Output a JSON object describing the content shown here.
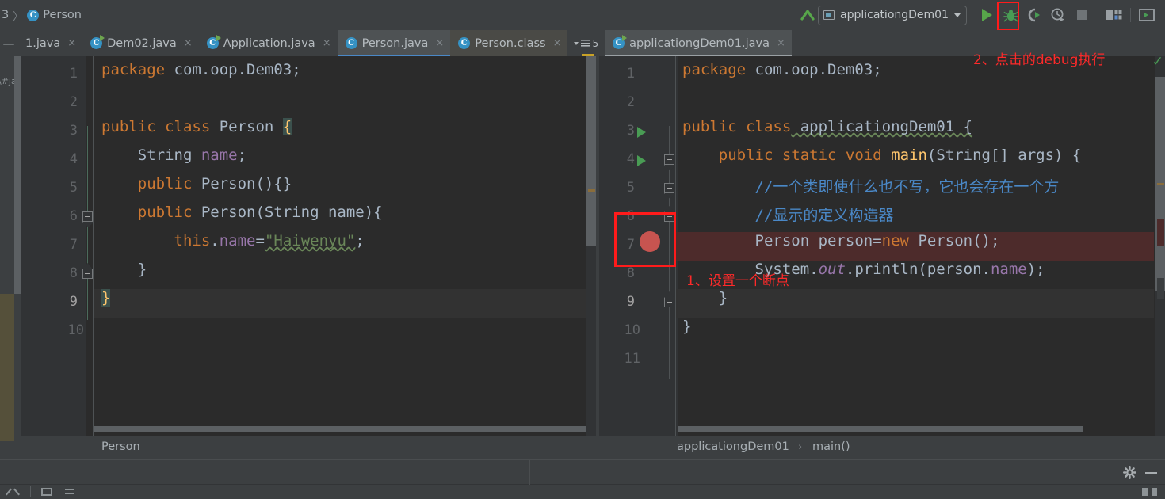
{
  "breadcrumb_top": {
    "prefix": "3",
    "separator": "〉",
    "class_icon": "C",
    "text": "Person"
  },
  "toolbar": {
    "back_arrow_icon": "arrow-up-left-icon",
    "run_config_name": "applicationgDem01",
    "run_config_caret": "▾",
    "buttons": [
      {
        "name": "run-button",
        "icon": "play-icon",
        "label": "Run"
      },
      {
        "name": "debug-button",
        "icon": "bug-icon",
        "label": "Debug"
      },
      {
        "name": "run-with-coverage-button",
        "icon": "coverage-icon",
        "label": "Run with Coverage"
      },
      {
        "name": "profiler-button",
        "icon": "clock-run-icon",
        "label": "Profiler"
      },
      {
        "name": "stop-button",
        "icon": "stop-square-icon",
        "label": "Stop"
      },
      {
        "name": "project-structure-button",
        "icon": "folder-structure-icon",
        "label": "Project Structure"
      },
      {
        "name": "terminal-button",
        "icon": "terminal-icon",
        "label": "Terminal"
      }
    ],
    "highlight_color": "#ff1b1b"
  },
  "tabs": {
    "collapse_label": "—",
    "items": [
      {
        "label": "1.java",
        "icon": "none",
        "state": "inactive",
        "close": "×"
      },
      {
        "label": "Dem02.java",
        "icon": "java-run-class-icon",
        "state": "inactive",
        "close": "×"
      },
      {
        "label": "Application.java",
        "icon": "java-run-class-icon",
        "state": "inactive",
        "close": "×"
      },
      {
        "label": "Person.java",
        "icon": "java-class-icon",
        "state": "active-left",
        "close": "×"
      },
      {
        "label": "Person.class",
        "icon": "java-class-icon",
        "state": "passive-selected",
        "close": "×"
      }
    ],
    "more_count": "5",
    "right_tab": {
      "label": "applicationgDem01.java",
      "icon": "java-run-class-icon",
      "state": "active-right",
      "close": "×"
    }
  },
  "left_editor": {
    "vertical_label": "\\#ja",
    "file": "Person.java",
    "current_line": 9,
    "line_numbers": [
      "1",
      "2",
      "3",
      "4",
      "5",
      "6",
      "7",
      "8",
      "9",
      "10"
    ],
    "lines": [
      {
        "n": 1,
        "segments": [
          {
            "t": "package",
            "c": "k"
          },
          {
            "t": " com.oop.Dem03;",
            "c": "ty"
          }
        ]
      },
      {
        "n": 2,
        "segments": []
      },
      {
        "n": 3,
        "segments": [
          {
            "t": "public class",
            "c": "k"
          },
          {
            "t": " Person ",
            "c": "ty"
          },
          {
            "t": "{",
            "c": "yb"
          }
        ]
      },
      {
        "n": 4,
        "segments": [
          {
            "t": "    String ",
            "c": "ty"
          },
          {
            "t": "name",
            "c": "fld"
          },
          {
            "t": ";",
            "c": "ty"
          }
        ]
      },
      {
        "n": 5,
        "segments": [
          {
            "t": "    ",
            "c": "ty"
          },
          {
            "t": "public",
            "c": "k"
          },
          {
            "t": " Person(){}",
            "c": "ty"
          }
        ]
      },
      {
        "n": 6,
        "segments": [
          {
            "t": "    ",
            "c": "ty"
          },
          {
            "t": "public",
            "c": "k"
          },
          {
            "t": " Person(String name){",
            "c": "ty"
          }
        ]
      },
      {
        "n": 7,
        "segments": [
          {
            "t": "        ",
            "c": "ty"
          },
          {
            "t": "this",
            "c": "k"
          },
          {
            "t": ".",
            "c": "ty"
          },
          {
            "t": "name",
            "c": "fld"
          },
          {
            "t": "=",
            "c": "ty"
          },
          {
            "t": "\"Haiwenyu\"",
            "c": "str"
          },
          {
            "t": ";",
            "c": "ty"
          }
        ]
      },
      {
        "n": 8,
        "segments": [
          {
            "t": "    }",
            "c": "ty"
          }
        ]
      },
      {
        "n": 9,
        "segments": [
          {
            "t": "}",
            "c": "yb"
          }
        ]
      },
      {
        "n": 10,
        "segments": []
      }
    ],
    "breadcrumb": "Person"
  },
  "right_editor": {
    "file": "applicationgDem01.java",
    "current_line": 9,
    "breakpoint_line": 7,
    "run_gutter_lines": [
      3,
      4
    ],
    "line_numbers": [
      "1",
      "2",
      "3",
      "4",
      "5",
      "6",
      "7",
      "8",
      "9",
      "10",
      "11"
    ],
    "lines": [
      {
        "n": 1,
        "segments": [
          {
            "t": "package",
            "c": "k"
          },
          {
            "t": " com.oop.Dem03;",
            "c": "ty"
          }
        ]
      },
      {
        "n": 2,
        "segments": []
      },
      {
        "n": 3,
        "segments": [
          {
            "t": "public class",
            "c": "k"
          },
          {
            "t": " applicationgDem01 {",
            "c": "ty"
          }
        ]
      },
      {
        "n": 4,
        "segments": [
          {
            "t": "    ",
            "c": "ty"
          },
          {
            "t": "public static void",
            "c": "k"
          },
          {
            "t": " ",
            "c": "ty"
          },
          {
            "t": "main",
            "c": "meth"
          },
          {
            "t": "(String[] args) {",
            "c": "ty"
          }
        ]
      },
      {
        "n": 5,
        "segments": [
          {
            "t": "        ",
            "c": "ty"
          },
          {
            "t": "//一个类即使什么也不写，它也会存在一个方",
            "c": "cmt"
          }
        ]
      },
      {
        "n": 6,
        "segments": [
          {
            "t": "        ",
            "c": "ty"
          },
          {
            "t": "//显示的定义构造器",
            "c": "cmt"
          }
        ]
      },
      {
        "n": 7,
        "segments": [
          {
            "t": "        Person person=",
            "c": "ty"
          },
          {
            "t": "new",
            "c": "k"
          },
          {
            "t": " Person();",
            "c": "ty"
          }
        ]
      },
      {
        "n": 8,
        "segments": [
          {
            "t": "        System.",
            "c": "ty"
          },
          {
            "t": "out",
            "c": "stat"
          },
          {
            "t": ".println(person.",
            "c": "ty"
          },
          {
            "t": "name",
            "c": "fld"
          },
          {
            "t": ");",
            "c": "ty"
          }
        ]
      },
      {
        "n": 9,
        "segments": [
          {
            "t": "    }",
            "c": "ty"
          }
        ]
      },
      {
        "n": 10,
        "segments": [
          {
            "t": "}",
            "c": "ty"
          }
        ]
      },
      {
        "n": 11,
        "segments": []
      }
    ],
    "breadcrumb": {
      "class": "applicationgDem01",
      "separator": "›",
      "method": "main()"
    },
    "inspection_status_icon": "green-checkmark-icon"
  },
  "annotations": [
    {
      "id": "annot-breakpoint",
      "text": "1、设置一个断点",
      "color": "#ff2a2a"
    },
    {
      "id": "annot-debug",
      "text": "2、点击的debug执行",
      "color": "#ff2a2a"
    }
  ],
  "status_bar": {
    "gear_icon": "gear-icon",
    "minimize_icon": "minimize-icon"
  }
}
